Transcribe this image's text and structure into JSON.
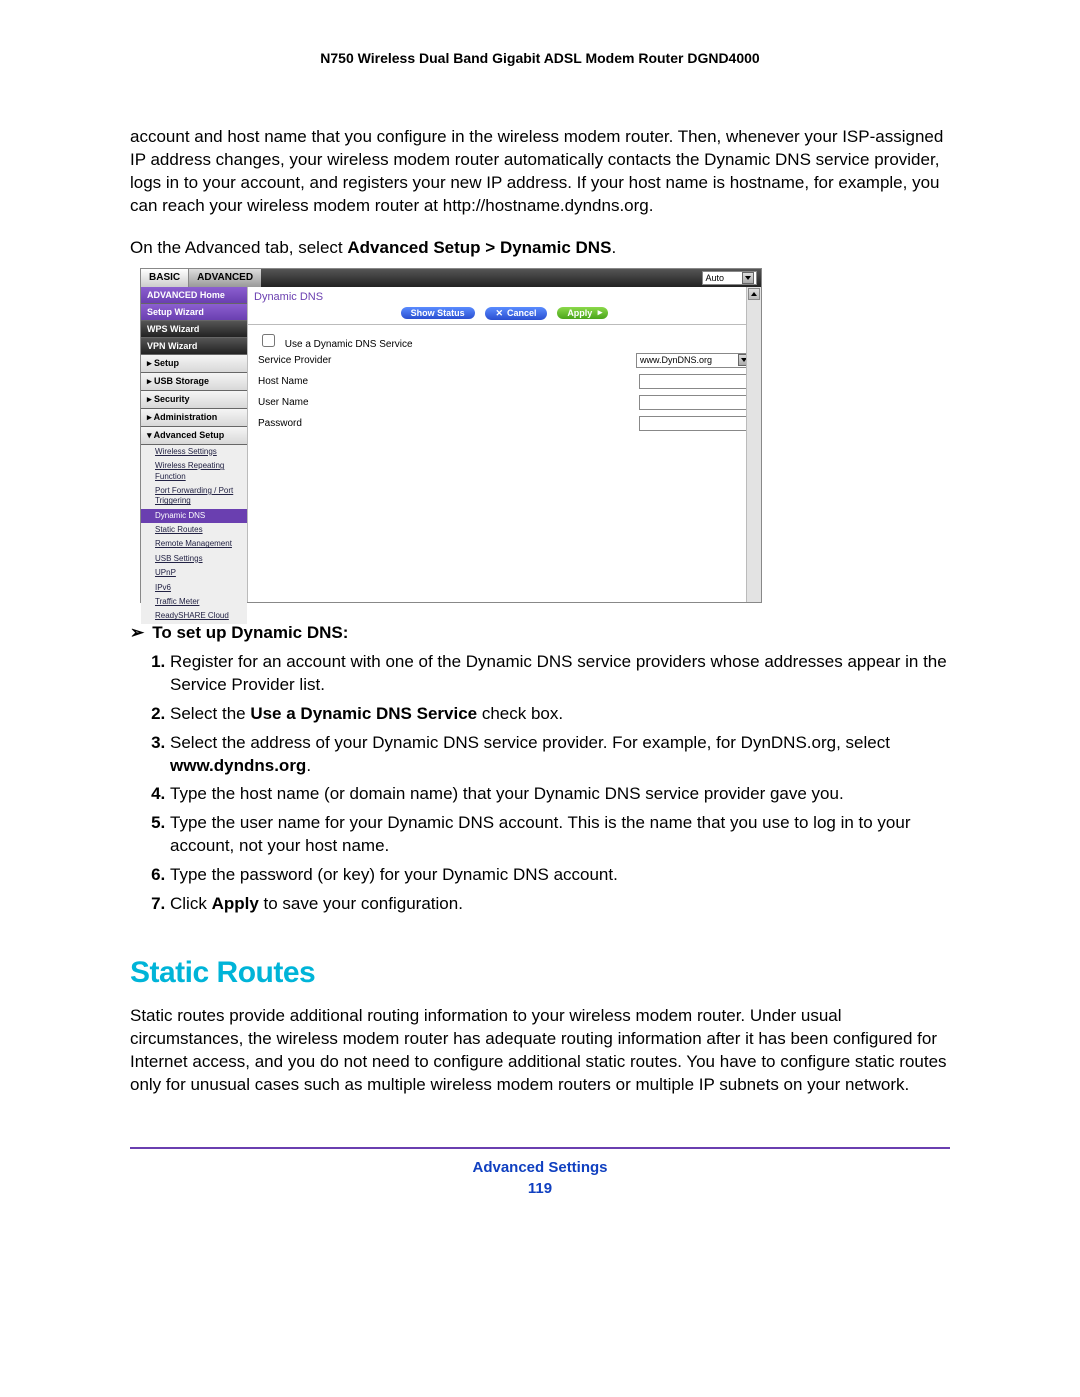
{
  "doc_title": "N750 Wireless Dual Band Gigabit ADSL Modem Router DGND4000",
  "intro_para": "account and host name that you configure in the wireless modem router. Then, whenever your ISP-assigned IP address changes, your wireless modem router automatically contacts the Dynamic DNS service provider, logs in to your account, and registers your new IP address. If your host name is hostname, for example, you can reach your wireless modem router at http://hostname.dyndns.org.",
  "nav_line_pre": "On the Advanced tab, select ",
  "nav_line_bold": "Advanced Setup > Dynamic DNS",
  "nav_line_post": ".",
  "router": {
    "tab_basic": "BASIC",
    "tab_advanced": "ADVANCED",
    "auto_label": "Auto",
    "panel_title": "Dynamic DNS",
    "btn_show": "Show Status",
    "btn_cancel": "Cancel",
    "btn_apply": "Apply",
    "checkbox_label": "Use a Dynamic DNS Service",
    "f_service": "Service Provider",
    "f_service_val": "www.DynDNS.org",
    "f_host": "Host Name",
    "f_user": "User Name",
    "f_pass": "Password",
    "sidebar": {
      "home": "ADVANCED Home",
      "setup_wiz": "Setup Wizard",
      "wps_wiz": "WPS Wizard",
      "vpn_wiz": "VPN Wizard",
      "setup": "▸ Setup",
      "usb": "▸ USB Storage",
      "security": "▸ Security",
      "admin": "▸ Administration",
      "adv_setup": "▾ Advanced Setup",
      "subs": {
        "wireless": "Wireless Settings",
        "repeat": "Wireless Repeating Function",
        "portfwd": "Port Forwarding / Port Triggering",
        "ddns": "Dynamic DNS",
        "static": "Static Routes",
        "remote": "Remote Management",
        "usbset": "USB Settings",
        "upnp": "UPnP",
        "ipv6": "IPv6",
        "traffic": "Traffic Meter",
        "ready": "ReadySHARE Cloud"
      }
    }
  },
  "howto_title": "To set up Dynamic DNS:",
  "steps": {
    "s1": "Register for an account with one of the Dynamic DNS service providers whose addresses appear in the Service Provider list.",
    "s2a": "Select the ",
    "s2b": "Use a Dynamic DNS Service",
    "s2c": " check box.",
    "s3a": "Select the address of your Dynamic DNS service provider. For example, for DynDNS.org, select ",
    "s3b": "www.dyndns.org",
    "s3c": ".",
    "s4": "Type the host name (or domain name) that your Dynamic DNS service provider gave you.",
    "s5": "Type the user name for your Dynamic DNS account. This is the name that you use to log in to your account, not your host name.",
    "s6": "Type the password (or key) for your Dynamic DNS account.",
    "s7a": "Click ",
    "s7b": "Apply",
    "s7c": " to save your configuration."
  },
  "section_heading": "Static Routes",
  "static_para": "Static routes provide additional routing information to your wireless modem router. Under usual circumstances, the wireless modem router has adequate routing information after it has been configured for Internet access, and you do not need to configure additional static routes. You have to configure static routes only for unusual cases such as multiple wireless modem routers or multiple IP subnets on your network.",
  "footer_label": "Advanced Settings",
  "page_num": "119"
}
